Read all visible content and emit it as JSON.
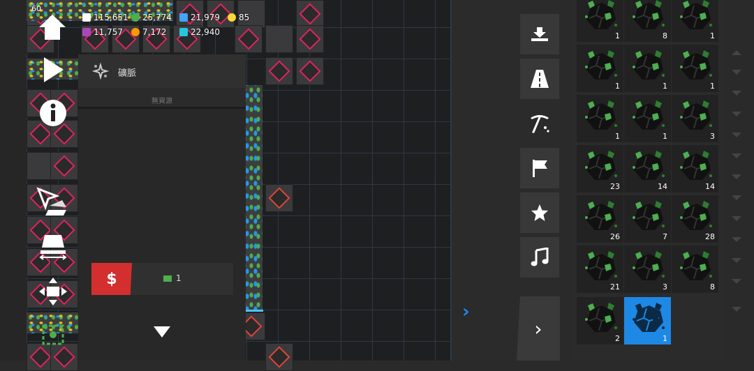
{
  "hud": {
    "fps": "60",
    "resources": [
      {
        "icon": "money-icon",
        "value": "115,651",
        "color": "#ffffff"
      },
      {
        "icon": "green-resource-icon",
        "value": "25,774",
        "color": "#4caf50"
      },
      {
        "icon": "blue-resource-icon",
        "value": "21,979",
        "color": "#42a5f5"
      },
      {
        "icon": "yellow-resource-icon",
        "value": "85",
        "color": "#fdd835"
      },
      {
        "icon": "purple-resource-icon",
        "value": "11,757",
        "color": "#ab47bc"
      },
      {
        "icon": "orange-resource-icon",
        "value": "7,172",
        "color": "#ff9800"
      },
      {
        "icon": "cyan-resource-icon",
        "value": "22,940",
        "color": "#26c6da"
      }
    ]
  },
  "panel": {
    "title": "礦脈",
    "no_resources": "無資源",
    "sell_value": "1"
  },
  "items": {
    "counts": [
      "1",
      "8",
      "1",
      "1",
      "1",
      "1",
      "1",
      "1",
      "3",
      "23",
      "14",
      "14",
      "26",
      "7",
      "28",
      "21",
      "3",
      "8",
      "2",
      "1"
    ]
  },
  "colors": {
    "accent_blue": "#1e88e5",
    "sell_red": "#d32f2f",
    "ore_green": "#4caf50"
  }
}
